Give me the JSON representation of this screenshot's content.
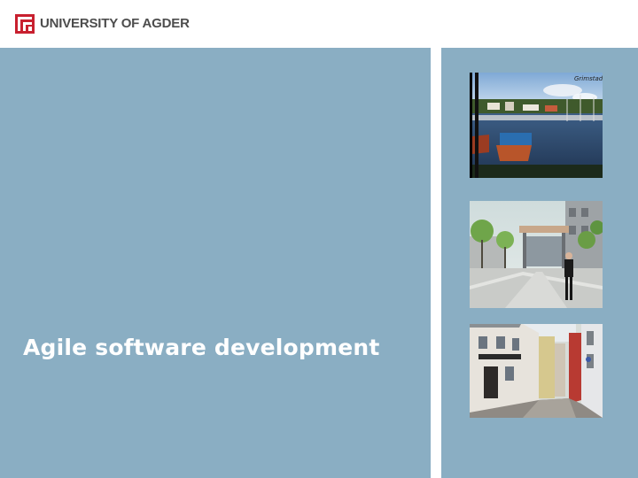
{
  "header": {
    "logo_text": "UNIVERSITY OF AGDER",
    "logo_icon": "uia-logo-icon",
    "brand_color": "#c8202f"
  },
  "slide": {
    "title": "Agile software development",
    "background_color": "#8aaec3"
  },
  "photos": [
    {
      "name": "harbor-photo",
      "caption": "Grimstad"
    },
    {
      "name": "plaza-photo"
    },
    {
      "name": "street-photo"
    }
  ]
}
